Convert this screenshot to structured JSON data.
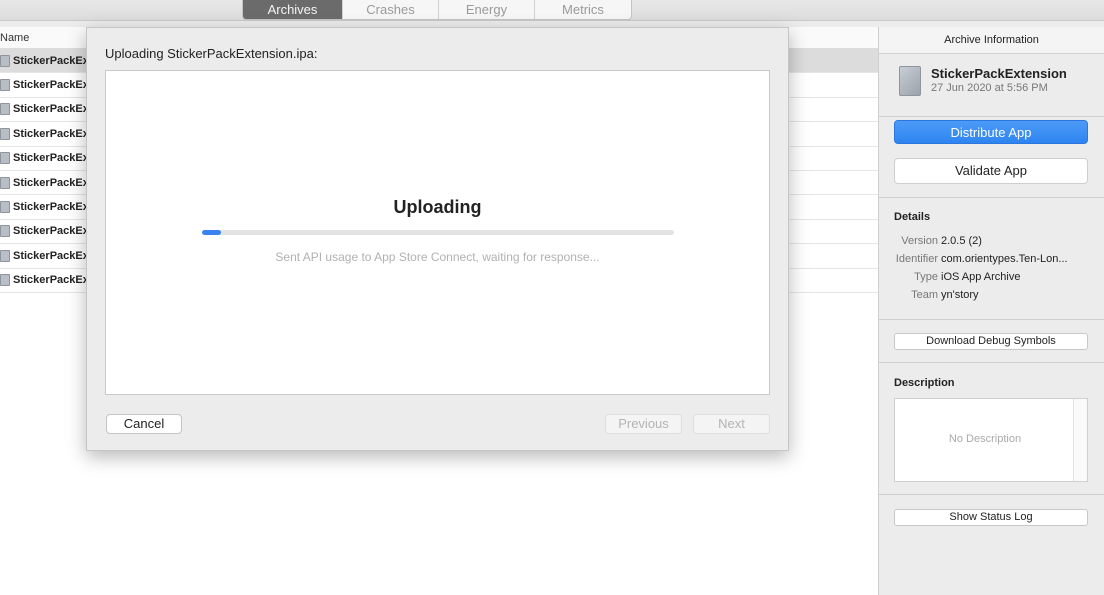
{
  "tabs": [
    {
      "label": "Archives",
      "active": true
    },
    {
      "label": "Crashes",
      "active": false
    },
    {
      "label": "Energy",
      "active": false
    },
    {
      "label": "Metrics",
      "active": false
    }
  ],
  "list": {
    "header": "Name",
    "rows": [
      "StickerPackEx",
      "StickerPackEx",
      "StickerPackEx",
      "StickerPackEx",
      "StickerPackEx",
      "StickerPackEx",
      "StickerPackEx",
      "StickerPackEx",
      "StickerPackEx",
      "StickerPackEx"
    ]
  },
  "sheet": {
    "title": "Uploading StickerPackExtension.ipa:",
    "heading": "Uploading",
    "progress_fraction": 0.04,
    "status": "Sent API usage to App Store Connect, waiting for response...",
    "cancel_label": "Cancel",
    "previous_label": "Previous",
    "next_label": "Next"
  },
  "inspector": {
    "header": "Archive Information",
    "archive_name": "StickerPackExtension",
    "archive_date": "27 Jun 2020 at 5:56 PM",
    "distribute_label": "Distribute App",
    "validate_label": "Validate App",
    "details_title": "Details",
    "details": [
      {
        "label": "Version",
        "value": "2.0.5 (2)"
      },
      {
        "label": "Identifier",
        "value": "com.orientypes.Ten-Lon..."
      },
      {
        "label": "Type",
        "value": "iOS App Archive"
      },
      {
        "label": "Team",
        "value": "yn'story"
      }
    ],
    "download_symbols_label": "Download Debug Symbols",
    "description_title": "Description",
    "description_placeholder": "No Description",
    "show_log_label": "Show Status Log"
  },
  "colors": {
    "accent": "#2f84f0",
    "progress": "#3a82f2"
  }
}
